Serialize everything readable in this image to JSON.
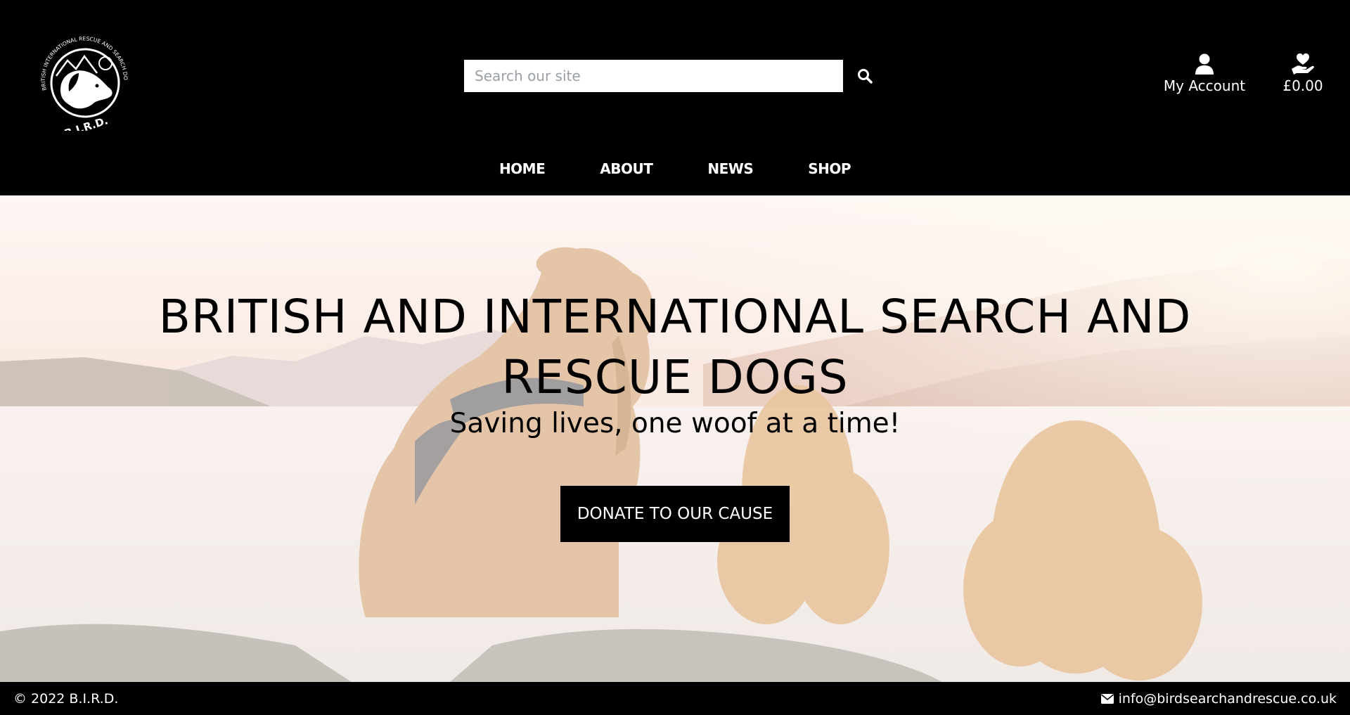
{
  "header": {
    "logo": {
      "text_ring": "BRITISH INTERNATIONAL RESCUE AND SEARCH DOGS",
      "initials": "B.I.R.D.",
      "icon": "dog-mountain-logo"
    },
    "search": {
      "placeholder": "Search our site",
      "icon": "search-icon"
    },
    "account": {
      "label": "My Account",
      "icon": "user-icon"
    },
    "cart": {
      "label": "£0.00",
      "icon": "donate-heart-hand-icon"
    },
    "nav": [
      {
        "label": "HOME"
      },
      {
        "label": "ABOUT"
      },
      {
        "label": "NEWS"
      },
      {
        "label": "SHOP"
      }
    ]
  },
  "hero": {
    "title_line1": "BRITISH AND INTERNATIONAL SEARCH AND",
    "title_line2": "RESCUE DOGS",
    "subtitle": "Saving lives, one woof at a time!",
    "donate_label": "DONATE TO OUR CAUSE"
  },
  "footer": {
    "copyright": "© 2022 B.I.R.D.",
    "email": "info@birdsearchandrescue.co.uk",
    "email_icon": "envelope-icon"
  },
  "colors": {
    "header_bg": "#000000",
    "footer_bg": "#000000",
    "button_bg": "#000000",
    "text_light": "#ffffff",
    "text_dark": "#000000"
  }
}
